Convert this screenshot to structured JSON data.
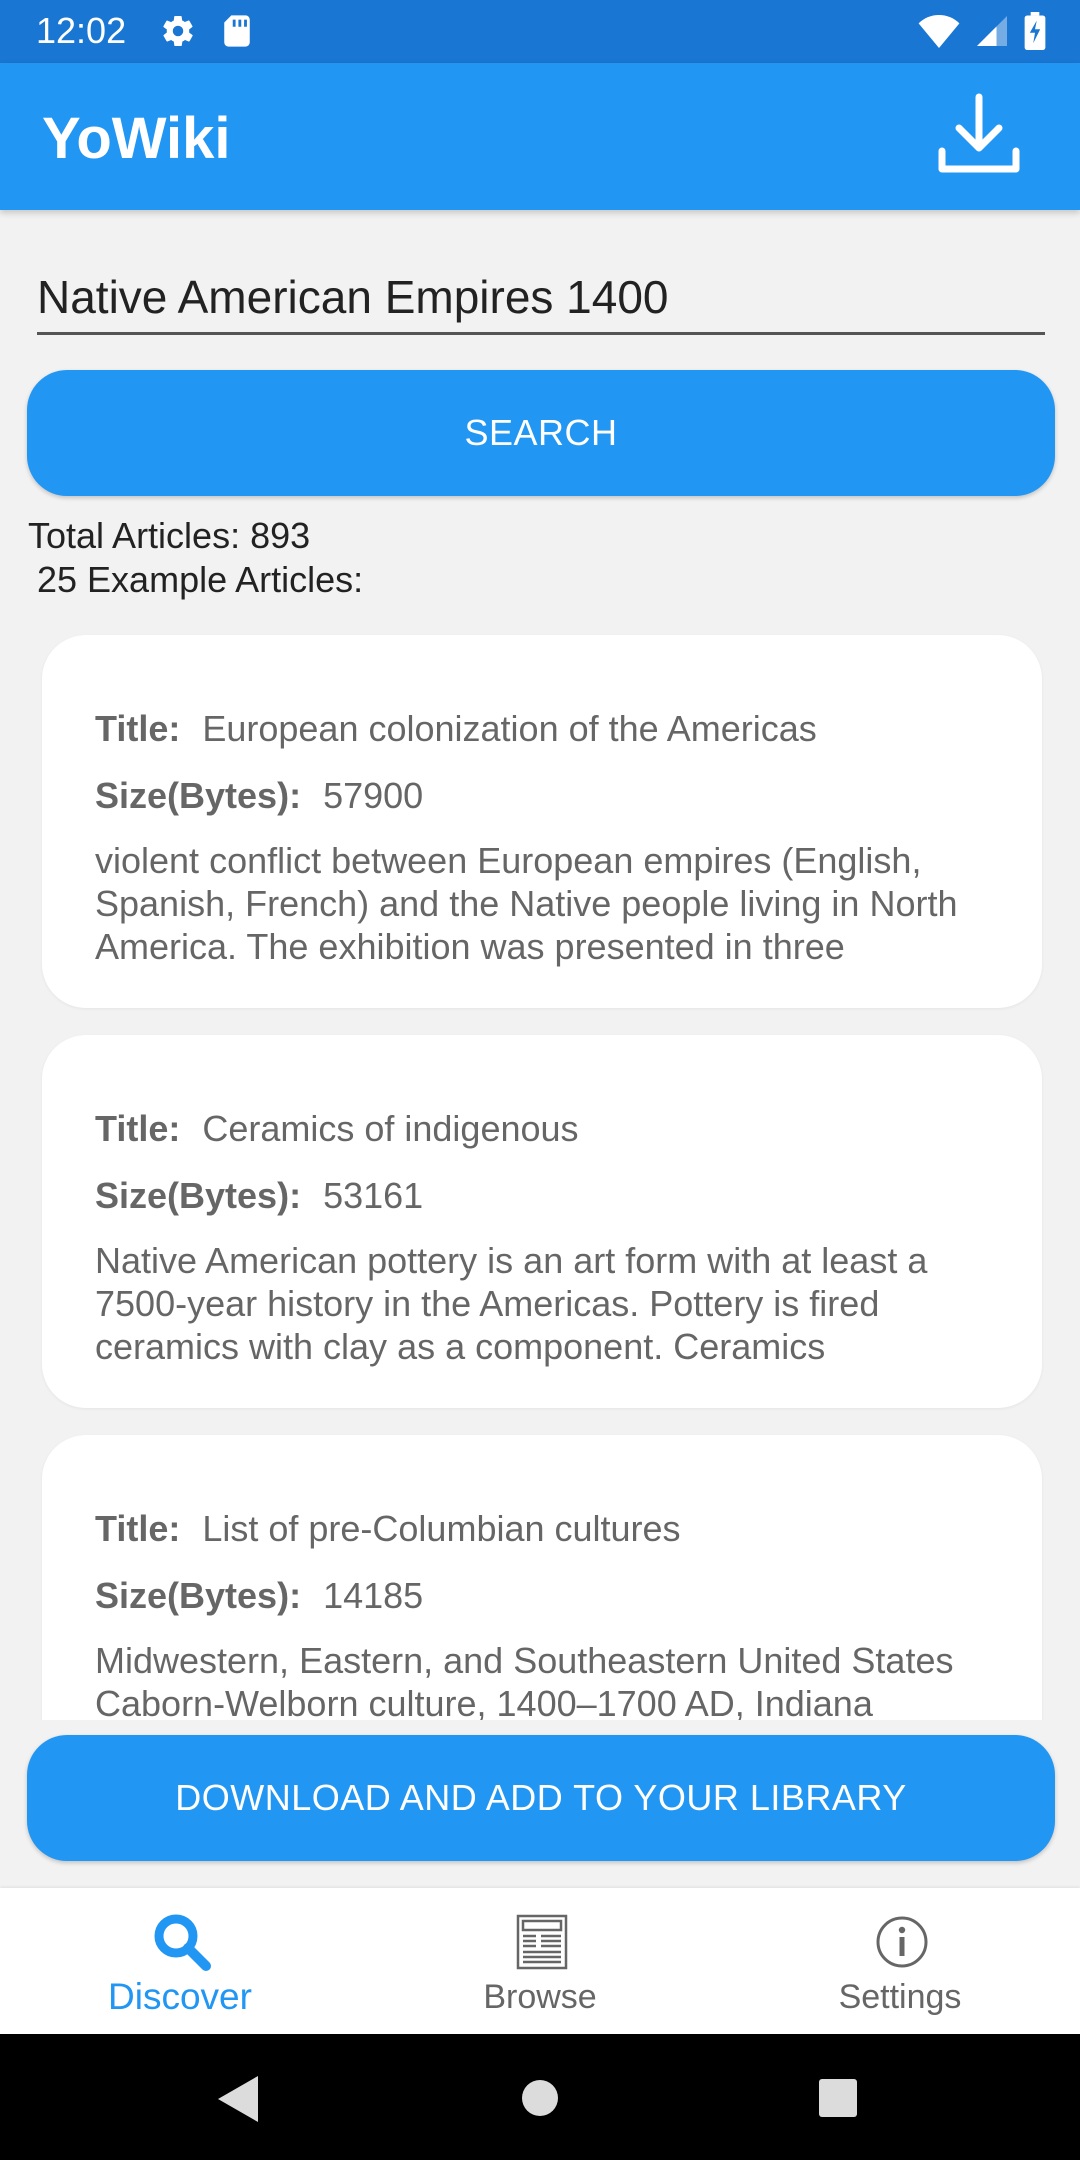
{
  "status_bar": {
    "time": "12:02"
  },
  "app_bar": {
    "title": "YoWiki"
  },
  "search": {
    "value": "Native American Empires 1400",
    "button_label": "SEARCH"
  },
  "summary": {
    "total": "Total Articles: 893",
    "examples": "25 Example Articles:"
  },
  "labels": {
    "title": "Title:",
    "size": "Size(Bytes):"
  },
  "articles": [
    {
      "title": "European colonization of the Americas",
      "size": "57900",
      "snippet": "violent conflict between European empires (English, Spanish, French) and the Native people living in North America. The exhibition was presented in three"
    },
    {
      "title": "Ceramics of indigenous",
      "size": "53161",
      "snippet": "Native American pottery is an art form with at least a 7500-year history in the Americas. Pottery is fired ceramics with clay as a component. Ceramics"
    },
    {
      "title": "List of pre-Columbian cultures",
      "size": "14185",
      "snippet": "Midwestern, Eastern, and Southeastern United States Caborn-Welborn culture, 1400–1700 AD, Indiana"
    }
  ],
  "download_button": {
    "label": "DOWNLOAD AND ADD TO YOUR LIBRARY"
  },
  "bottom_nav": {
    "discover": "Discover",
    "browse": "Browse",
    "settings": "Settings"
  },
  "colors": {
    "accent": "#2196f3",
    "status_bar": "#1976d2"
  }
}
